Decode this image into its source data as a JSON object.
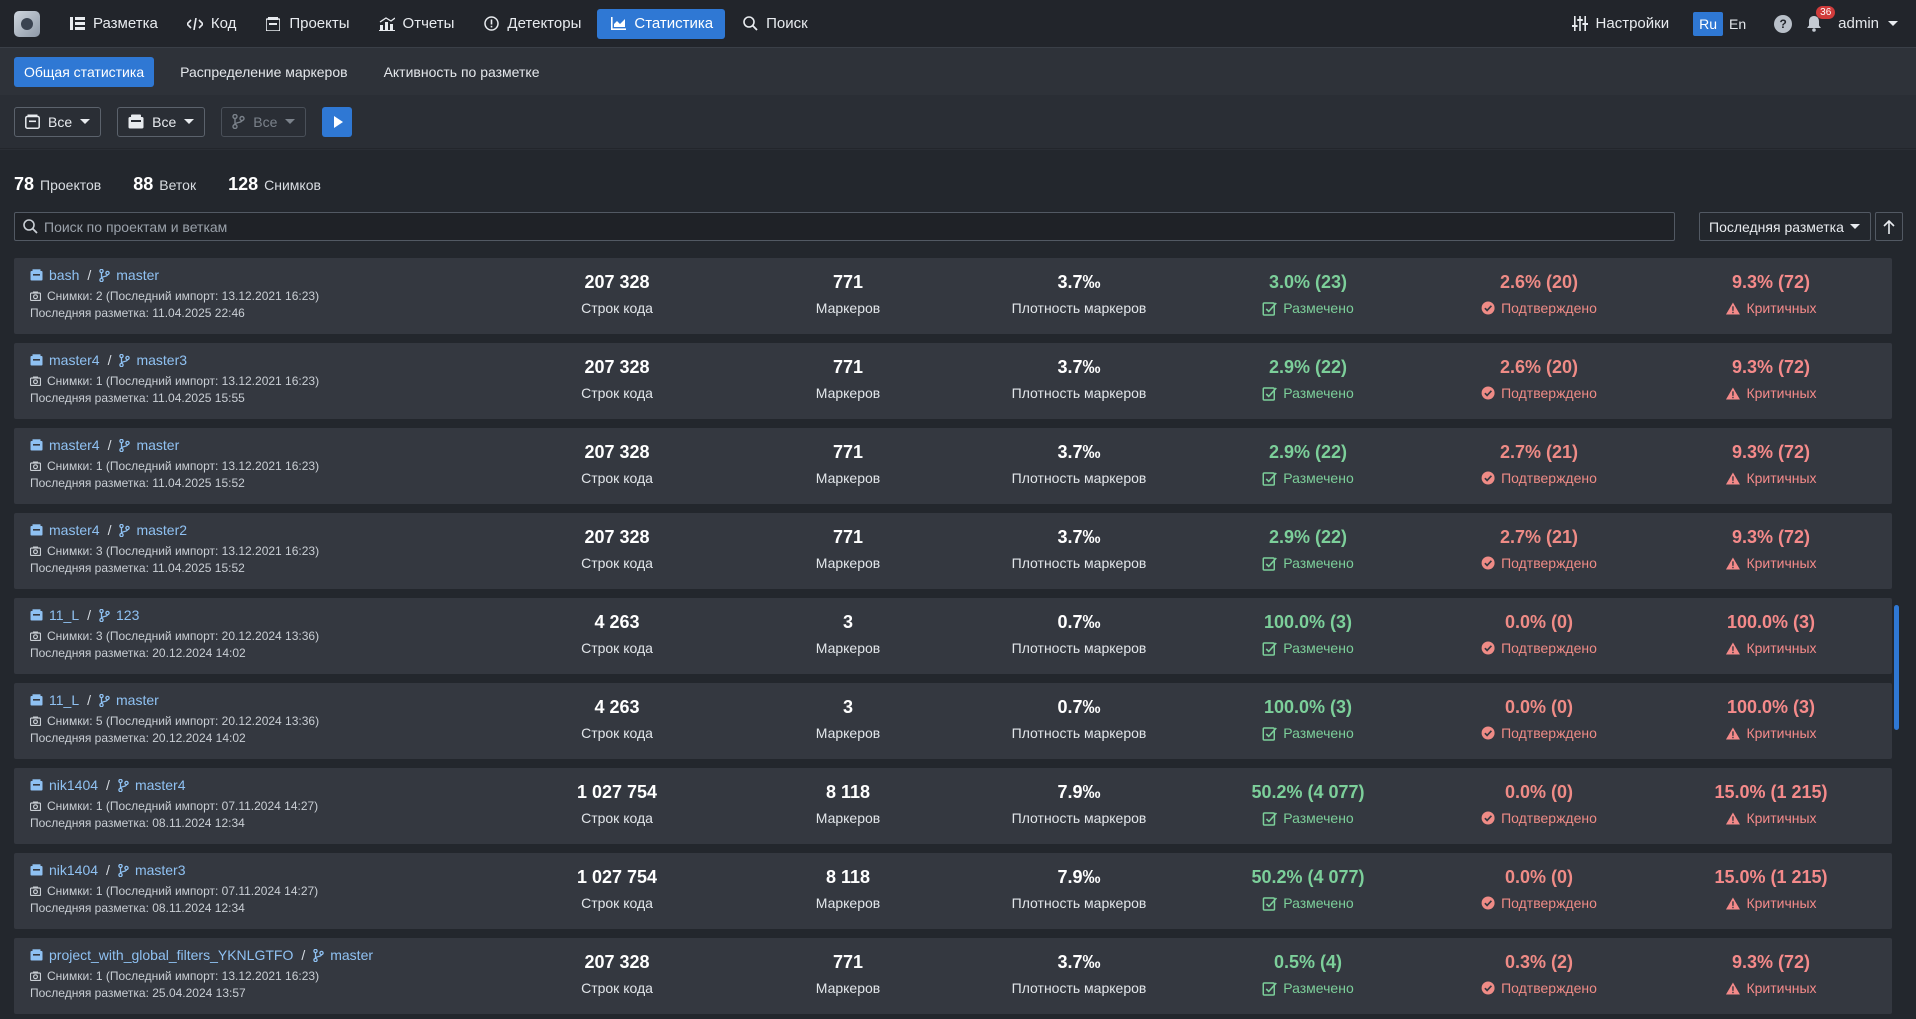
{
  "nav": {
    "items": [
      {
        "label": "Разметка",
        "icon": "list-icon"
      },
      {
        "label": "Код",
        "icon": "code-icon"
      },
      {
        "label": "Проекты",
        "icon": "projects-icon"
      },
      {
        "label": "Отчеты",
        "icon": "reports-icon"
      },
      {
        "label": "Детекторы",
        "icon": "detector-icon"
      },
      {
        "label": "Статистика",
        "icon": "chart-icon",
        "active": true
      },
      {
        "label": "Поиск",
        "icon": "search-icon"
      }
    ],
    "settings_label": "Настройки",
    "lang_ru": "Ru",
    "lang_en": "En",
    "help": "?",
    "notifications_count": "36",
    "user": "admin"
  },
  "tabs": [
    "Общая статистика",
    "Распределение маркеров",
    "Активность по разметке"
  ],
  "filters": {
    "project": "Все",
    "snapshot": "Все",
    "branch": "Все"
  },
  "counts": {
    "projects_num": "78",
    "projects_label": "Проектов",
    "branches_num": "88",
    "branches_label": "Веток",
    "snapshots_num": "128",
    "snapshots_label": "Снимков"
  },
  "search": {
    "placeholder": "Поиск по проектам и веткам",
    "value": ""
  },
  "sort": {
    "label": "Последняя разметка"
  },
  "labels": {
    "loc": "Строк кода",
    "markers": "Маркеров",
    "density": "Плотность маркеров",
    "marked": "Размечено",
    "confirmed": "Подтверждено",
    "critical": "Критичных"
  },
  "colors": {
    "accent": "#2f78d4",
    "link": "#8fc1f2",
    "green": "#7ccf9a",
    "red": "#ef8b86"
  },
  "rows": [
    {
      "project": "bash",
      "branch": "master",
      "snapshots": "Снимки: 2 (Последний импорт: 13.12.2021 16:23)",
      "last": "Последняя разметка: 11.04.2025 22:46",
      "loc": "207 328",
      "markers": "771",
      "density": "3.7‰",
      "marked": "3.0% (23)",
      "confirmed": "2.6% (20)",
      "critical": "9.3% (72)"
    },
    {
      "project": "master4",
      "branch": "master3",
      "snapshots": "Снимки: 1 (Последний импорт: 13.12.2021 16:23)",
      "last": "Последняя разметка: 11.04.2025 15:55",
      "loc": "207 328",
      "markers": "771",
      "density": "3.7‰",
      "marked": "2.9% (22)",
      "confirmed": "2.6% (20)",
      "critical": "9.3% (72)"
    },
    {
      "project": "master4",
      "branch": "master",
      "snapshots": "Снимки: 1 (Последний импорт: 13.12.2021 16:23)",
      "last": "Последняя разметка: 11.04.2025 15:52",
      "loc": "207 328",
      "markers": "771",
      "density": "3.7‰",
      "marked": "2.9% (22)",
      "confirmed": "2.7% (21)",
      "critical": "9.3% (72)"
    },
    {
      "project": "master4",
      "branch": "master2",
      "snapshots": "Снимки: 3 (Последний импорт: 13.12.2021 16:23)",
      "last": "Последняя разметка: 11.04.2025 15:52",
      "loc": "207 328",
      "markers": "771",
      "density": "3.7‰",
      "marked": "2.9% (22)",
      "confirmed": "2.7% (21)",
      "critical": "9.3% (72)"
    },
    {
      "project": "11_L",
      "branch": "123",
      "snapshots": "Снимки: 3 (Последний импорт: 20.12.2024 13:36)",
      "last": "Последняя разметка: 20.12.2024 14:02",
      "loc": "4 263",
      "markers": "3",
      "density": "0.7‰",
      "marked": "100.0% (3)",
      "confirmed": "0.0% (0)",
      "critical": "100.0% (3)"
    },
    {
      "project": "11_L",
      "branch": "master",
      "snapshots": "Снимки: 5 (Последний импорт: 20.12.2024 13:36)",
      "last": "Последняя разметка: 20.12.2024 14:02",
      "loc": "4 263",
      "markers": "3",
      "density": "0.7‰",
      "marked": "100.0% (3)",
      "confirmed": "0.0% (0)",
      "critical": "100.0% (3)"
    },
    {
      "project": "nik1404",
      "branch": "master4",
      "snapshots": "Снимки: 1 (Последний импорт: 07.11.2024 14:27)",
      "last": "Последняя разметка: 08.11.2024 12:34",
      "loc": "1 027 754",
      "markers": "8 118",
      "density": "7.9‰",
      "marked": "50.2% (4 077)",
      "confirmed": "0.0% (0)",
      "critical": "15.0% (1 215)"
    },
    {
      "project": "nik1404",
      "branch": "master3",
      "snapshots": "Снимки: 1 (Последний импорт: 07.11.2024 14:27)",
      "last": "Последняя разметка: 08.11.2024 12:34",
      "loc": "1 027 754",
      "markers": "8 118",
      "density": "7.9‰",
      "marked": "50.2% (4 077)",
      "confirmed": "0.0% (0)",
      "critical": "15.0% (1 215)"
    },
    {
      "project": "project_with_global_filters_YKNLGTFO",
      "branch": "master",
      "snapshots": "Снимки: 1 (Последний импорт: 13.12.2021 16:23)",
      "last": "Последняя разметка: 25.04.2024 13:57",
      "loc": "207 328",
      "markers": "771",
      "density": "3.7‰",
      "marked": "0.5% (4)",
      "confirmed": "0.3% (2)",
      "critical": "9.3% (72)"
    }
  ]
}
